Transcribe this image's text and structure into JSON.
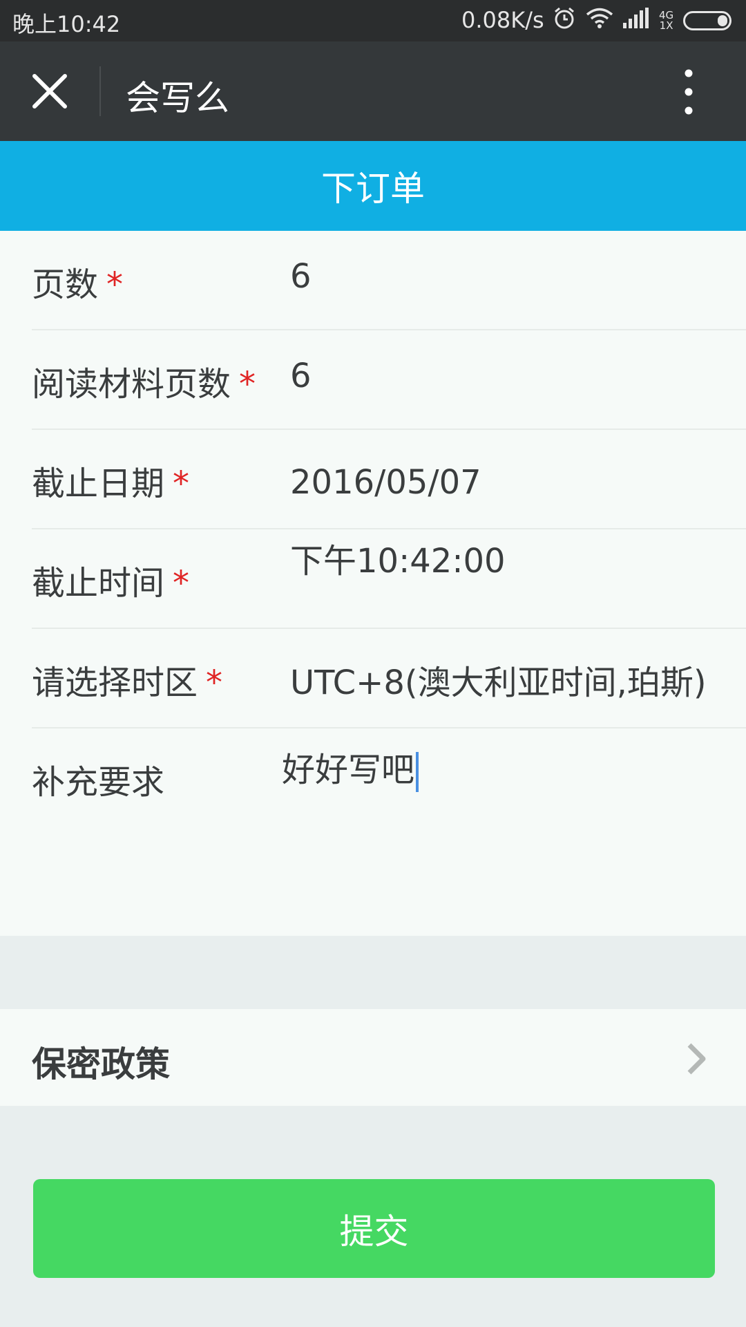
{
  "status_bar": {
    "time": "晚上10:42",
    "net_speed": "0.08K/s",
    "network_type_top": "4G",
    "network_type_bottom": "1X"
  },
  "title_bar": {
    "title": "会写么",
    "close_icon": "close-icon",
    "more_icon": "more-vertical-icon"
  },
  "page_header": {
    "title": "下订单"
  },
  "form": {
    "rows": [
      {
        "label": "页数",
        "required_mark": "*",
        "value": "6"
      },
      {
        "label": "阅读材料页数",
        "required_mark": "*",
        "value": "6"
      },
      {
        "label": "截止日期",
        "required_mark": "*",
        "value": "2016/05/07"
      },
      {
        "label": "截止时间",
        "required_mark": "*",
        "value": "下午10:42:00"
      },
      {
        "label": "请选择时区",
        "required_mark": "*",
        "value": "UTC+8(澳大利亚时间,珀斯)"
      }
    ],
    "notes": {
      "label": "补充要求",
      "value": "好好写吧"
    }
  },
  "policy": {
    "label": "保密政策",
    "chevron_icon": "chevron-right-icon"
  },
  "submit": {
    "label": "提交"
  },
  "colors": {
    "header_blue": "#10afe3",
    "titlebar_dark": "#34383a",
    "submit_green": "#45d862",
    "required_red": "#e02424"
  }
}
